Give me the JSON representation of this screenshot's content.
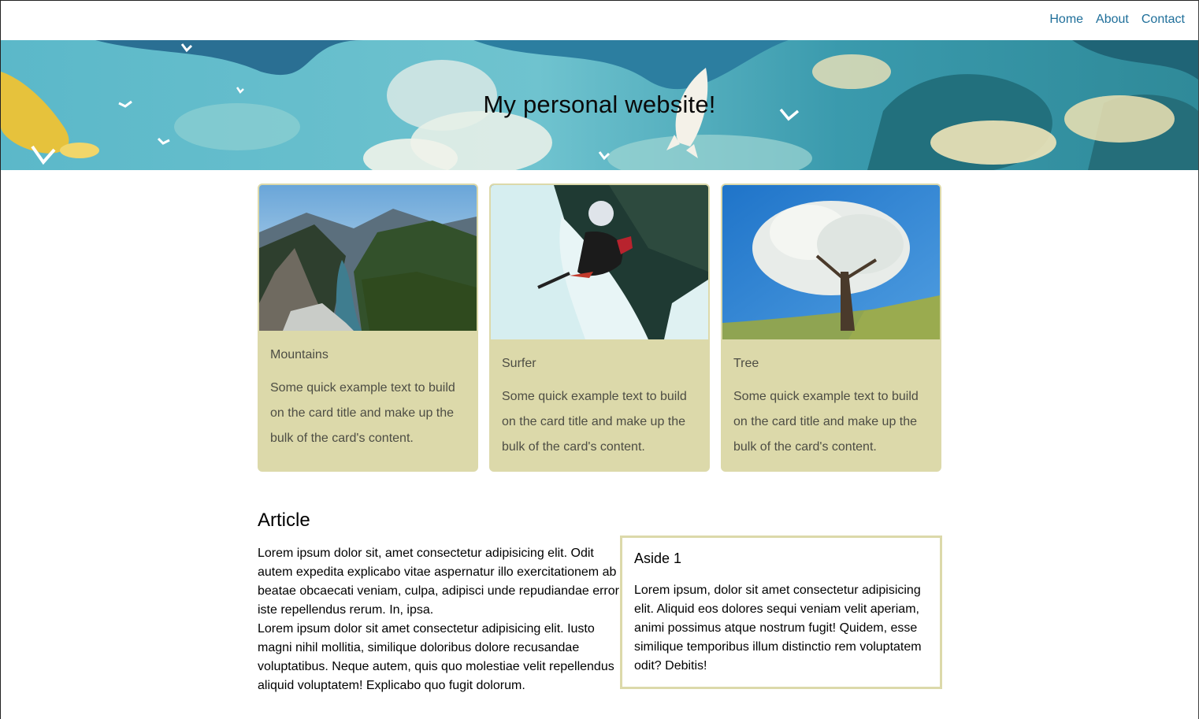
{
  "nav": {
    "items": [
      {
        "label": "Home"
      },
      {
        "label": "About"
      },
      {
        "label": "Contact"
      }
    ]
  },
  "hero": {
    "title": "My personal website!"
  },
  "cards": [
    {
      "title": "Mountains",
      "text": "Some quick example text to build on the card title and make up the bulk of the card's content."
    },
    {
      "title": "Surfer",
      "text": "Some quick example text to build on the card title and make up the bulk of the card's content."
    },
    {
      "title": "Tree",
      "text": "Some quick example text to build on the card title and make up the bulk of the card's content."
    }
  ],
  "article": {
    "title": "Article",
    "paragraphs": [
      "Lorem ipsum dolor sit, amet consectetur adipisicing elit. Odit autem expedita explicabo vitae aspernatur illo exercitationem ab beatae obcaecati veniam, culpa, adipisci unde repudiandae error iste repellendus rerum. In, ipsa.",
      "Lorem ipsum dolor sit amet consectetur adipisicing elit. Iusto magni nihil mollitia, similique doloribus dolore recusandae voluptatibus. Neque autem, quis quo molestiae velit repellendus aliquid voluptatem! Explicabo quo fugit dolorum."
    ]
  },
  "aside": {
    "title": "Aside 1",
    "text": "Lorem ipsum, dolor sit amet consectetur adipisicing elit. Aliquid eos dolores sequi veniam velit aperiam, animi possimus atque nostrum fugit! Quidem, esse similique temporibus illum distinctio rem voluptatem odit? Debitis!"
  },
  "colors": {
    "link": "#1f6f9a",
    "card_bg": "#dcd9aa",
    "card_text": "#4d4d44"
  }
}
